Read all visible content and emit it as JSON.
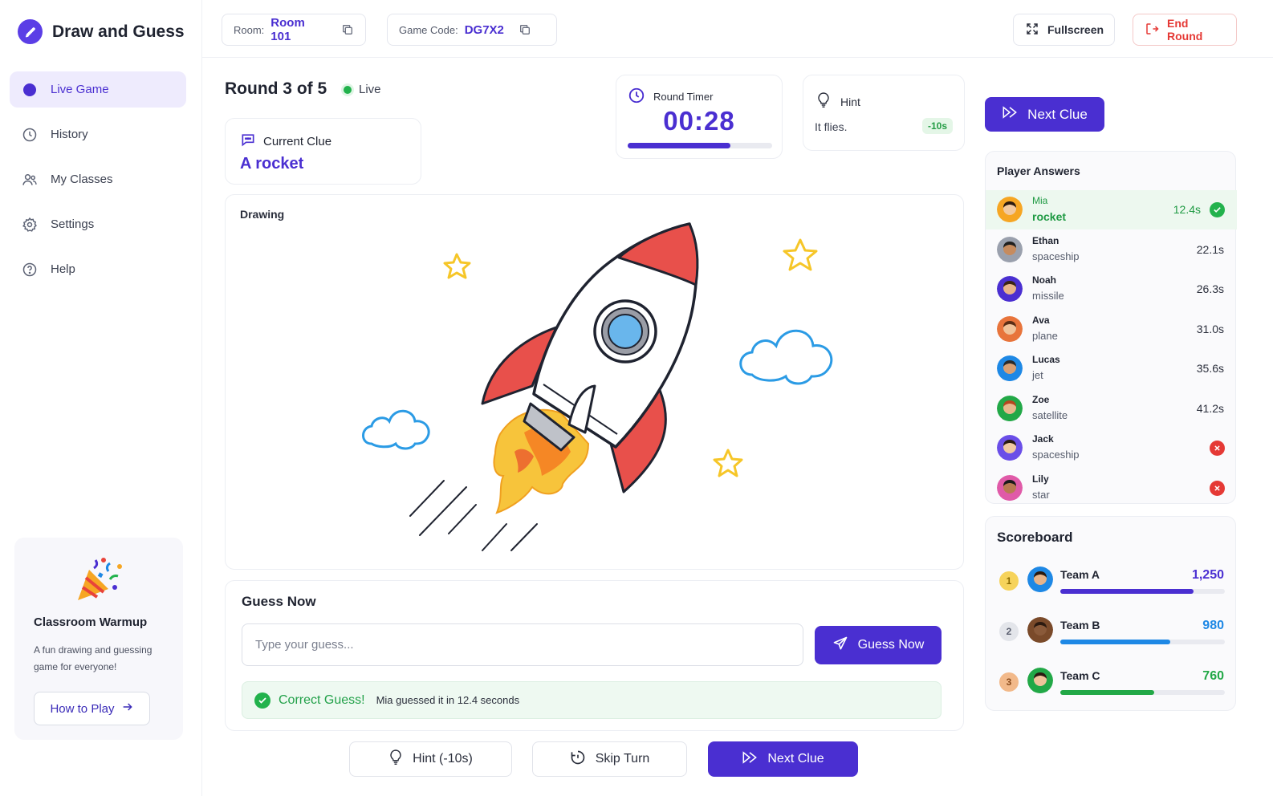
{
  "app": {
    "name": "Draw and Guess"
  },
  "sidebar": {
    "items": [
      {
        "label": "Live Game",
        "icon": "live-icon",
        "active": true
      },
      {
        "label": "History",
        "icon": "clock-icon"
      },
      {
        "label": "My Classes",
        "icon": "users-icon"
      },
      {
        "label": "Settings",
        "icon": "gear-icon"
      },
      {
        "label": "Help",
        "icon": "help-icon"
      }
    ],
    "promo": {
      "title": "Classroom Warmup",
      "description": "A fun drawing and guessing game for everyone!",
      "button": "How to Play"
    }
  },
  "topbar": {
    "room_label": "Room:",
    "room_value": "Room 101",
    "code_label": "Game Code:",
    "code_value": "DG7X2",
    "fullscreen": "Fullscreen",
    "end_round": "End Round"
  },
  "round": {
    "title": "Round 3 of 5",
    "status": "Live"
  },
  "clue": {
    "label": "Current Clue",
    "text": "A rocket"
  },
  "timer": {
    "label": "Round Timer",
    "value": "00:28",
    "progress": 0.71
  },
  "hint": {
    "label": "Hint",
    "text": "It flies.",
    "penalty": "-10s"
  },
  "drawing": {
    "label": "Drawing"
  },
  "guess": {
    "title": "Guess Now",
    "placeholder": "Type your guess...",
    "button": "Guess Now",
    "result_title": "Correct Guess!",
    "result_desc": "Mia guessed it in 12.4 seconds"
  },
  "actions": {
    "hint": "Hint (-10s)",
    "skip": "Skip Turn",
    "next": "Next Clue"
  },
  "next_clue_top": "Next Clue",
  "answers": {
    "title": "Player Answers",
    "rows": [
      {
        "name": "Mia",
        "guess": "rocket",
        "time": "12.4s",
        "status": "correct"
      },
      {
        "name": "Ethan",
        "guess": "spaceship",
        "time": "22.1s",
        "status": "none"
      },
      {
        "name": "Noah",
        "guess": "missile",
        "time": "26.3s",
        "status": "none"
      },
      {
        "name": "Ava",
        "guess": "plane",
        "time": "31.0s",
        "status": "none"
      },
      {
        "name": "Lucas",
        "guess": "jet",
        "time": "35.6s",
        "status": "none"
      },
      {
        "name": "Zoe",
        "guess": "satellite",
        "time": "41.2s",
        "status": "none"
      },
      {
        "name": "Jack",
        "guess": "spaceship",
        "time": "",
        "status": "wrong"
      },
      {
        "name": "Lily",
        "guess": "star",
        "time": "",
        "status": "wrong"
      }
    ]
  },
  "scoreboard": {
    "title": "Scoreboard",
    "teams": [
      {
        "rank": "1",
        "name": "Team A",
        "score": "1,250",
        "progress": 0.81,
        "color": "#4a2fd1"
      },
      {
        "rank": "2",
        "name": "Team B",
        "score": "980",
        "progress": 0.67,
        "color": "#1e88e5"
      },
      {
        "rank": "3",
        "name": "Team C",
        "score": "760",
        "progress": 0.57,
        "color": "#22a847"
      }
    ]
  },
  "colors": {
    "accent": "#4a2fd1",
    "success": "#22b24c",
    "danger": "#e53935"
  }
}
